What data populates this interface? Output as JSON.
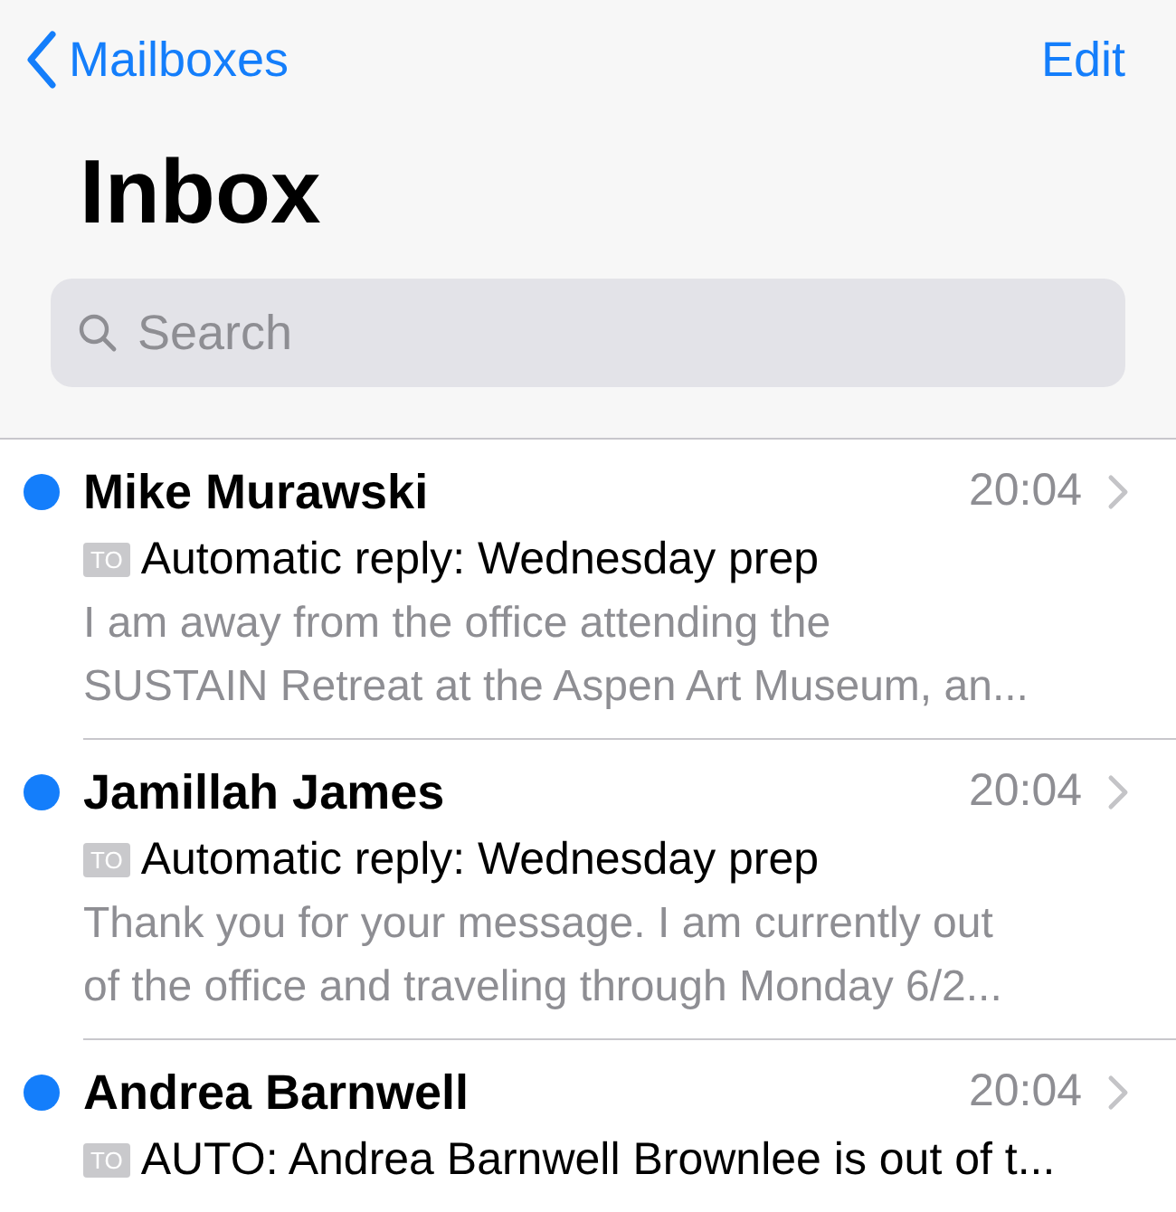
{
  "nav": {
    "back": "Mailboxes",
    "action": "Edit"
  },
  "title": "Inbox",
  "search": {
    "placeholder": "Search"
  },
  "messages": [
    {
      "sender": "Mike Murawski",
      "time": "20:04",
      "unread": true,
      "badge": "TO",
      "subject": "Automatic reply: Wednesday prep",
      "preview": [
        "I am away from the office attending the",
        "SUSTAIN Retreat at the Aspen Art Museum, an..."
      ]
    },
    {
      "sender": "Jamillah James",
      "time": "20:04",
      "unread": true,
      "badge": "TO",
      "subject": "Automatic reply: Wednesday prep",
      "preview": [
        "Thank you for your message. I am currently out",
        "of the office and traveling through Monday 6/2..."
      ]
    },
    {
      "sender": "Andrea Barnwell",
      "time": "20:04",
      "unread": true,
      "badge": "TO",
      "subject": "AUTO: Andrea Barnwell Brownlee is out of t..."
    }
  ]
}
